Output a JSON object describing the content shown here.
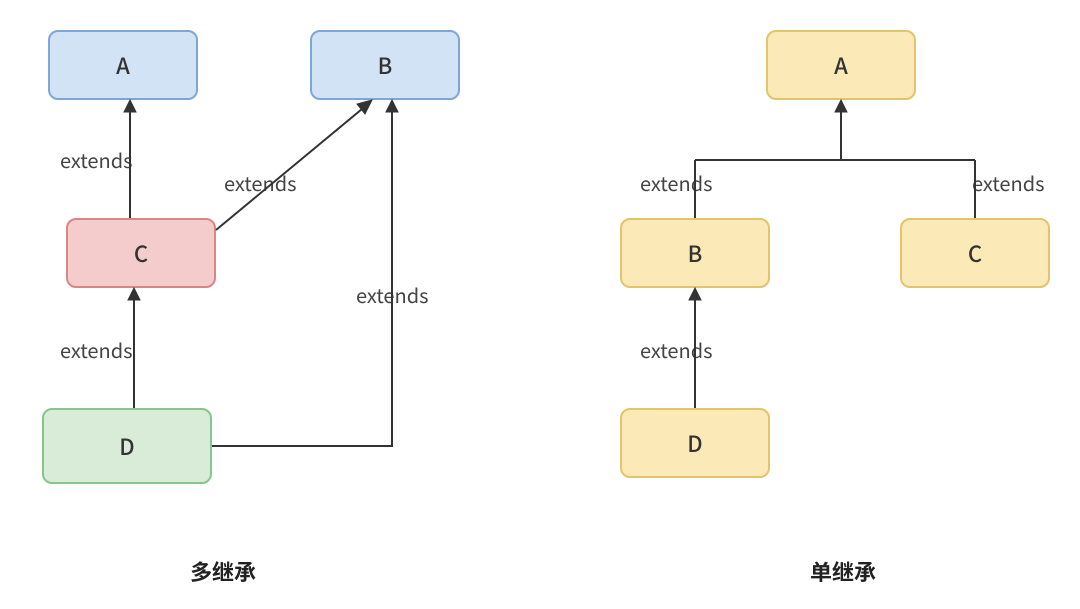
{
  "diagram": {
    "left": {
      "title": "多继承",
      "nodes": {
        "A": "A",
        "B": "B",
        "C": "C",
        "D": "D"
      },
      "edges": {
        "CA": "extends",
        "CB": "extends",
        "DC": "extends",
        "DB": "extends"
      }
    },
    "right": {
      "title": "单继承",
      "nodes": {
        "A": "A",
        "B": "B",
        "C": "C",
        "D": "D"
      },
      "edges": {
        "BA": "extends",
        "CA": "extends",
        "DB": "extends"
      }
    }
  },
  "chart_data": [
    {
      "type": "diagram",
      "title": "多继承",
      "nodes": [
        {
          "id": "A",
          "label": "A"
        },
        {
          "id": "B",
          "label": "B"
        },
        {
          "id": "C",
          "label": "C"
        },
        {
          "id": "D",
          "label": "D"
        }
      ],
      "edges": [
        {
          "from": "C",
          "to": "A",
          "label": "extends"
        },
        {
          "from": "C",
          "to": "B",
          "label": "extends"
        },
        {
          "from": "D",
          "to": "C",
          "label": "extends"
        },
        {
          "from": "D",
          "to": "B",
          "label": "extends"
        }
      ]
    },
    {
      "type": "diagram",
      "title": "单继承",
      "nodes": [
        {
          "id": "A",
          "label": "A"
        },
        {
          "id": "B",
          "label": "B"
        },
        {
          "id": "C",
          "label": "C"
        },
        {
          "id": "D",
          "label": "D"
        }
      ],
      "edges": [
        {
          "from": "B",
          "to": "A",
          "label": "extends"
        },
        {
          "from": "C",
          "to": "A",
          "label": "extends"
        },
        {
          "from": "D",
          "to": "B",
          "label": "extends"
        }
      ]
    }
  ]
}
